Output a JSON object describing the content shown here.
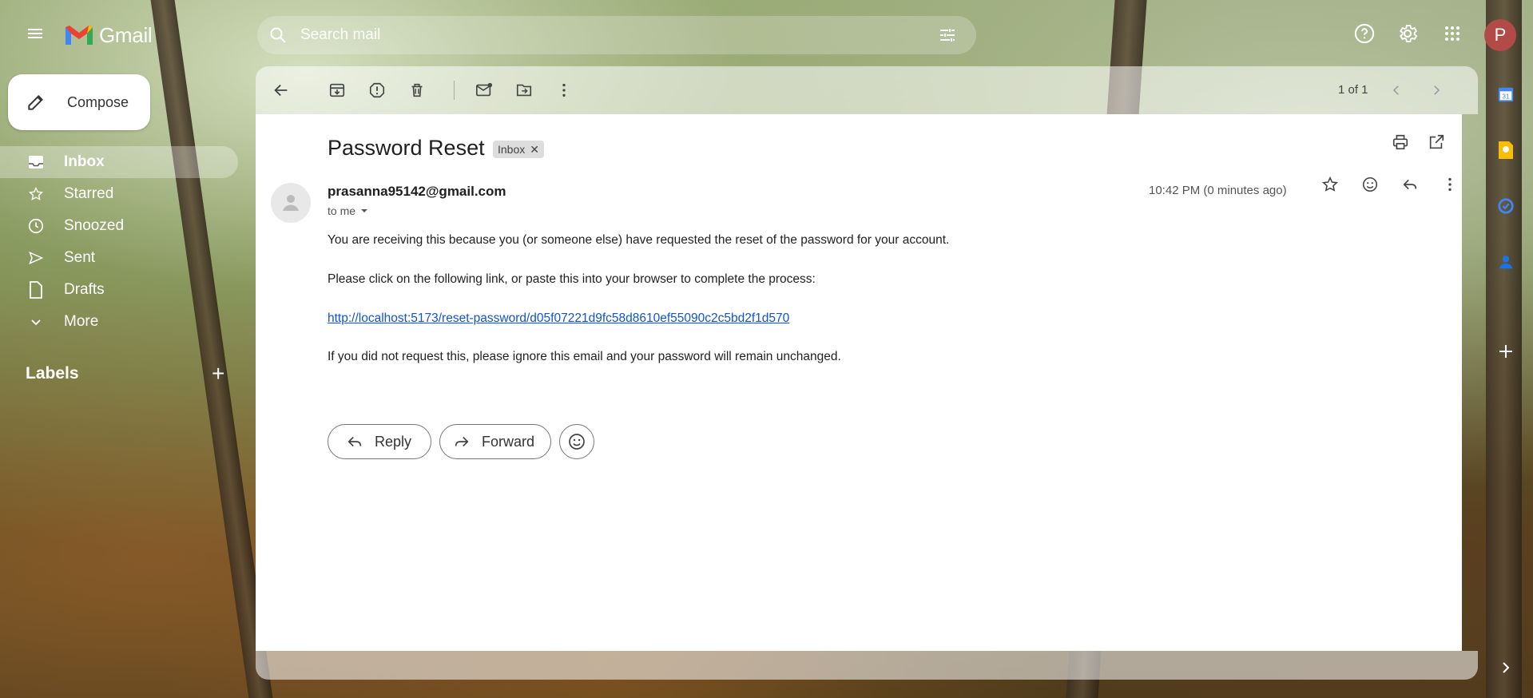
{
  "app": {
    "name": "Gmail"
  },
  "search": {
    "placeholder": "Search mail"
  },
  "account": {
    "initial": "P"
  },
  "compose": {
    "label": "Compose"
  },
  "nav": {
    "items": [
      {
        "label": "Inbox",
        "icon": "inbox-icon",
        "active": true
      },
      {
        "label": "Starred",
        "icon": "star-icon"
      },
      {
        "label": "Snoozed",
        "icon": "clock-icon"
      },
      {
        "label": "Sent",
        "icon": "send-icon"
      },
      {
        "label": "Drafts",
        "icon": "draft-icon"
      },
      {
        "label": "More",
        "icon": "chevron-down-icon"
      }
    ],
    "labels_heading": "Labels"
  },
  "toolbar": {
    "pager": "1 of 1"
  },
  "email": {
    "subject": "Password Reset",
    "chip": "Inbox",
    "sender": "prasanna95142@gmail.com",
    "to": "to me",
    "time": "10:42 PM (0 minutes ago)",
    "body": [
      "You are receiving this because you (or someone else) have requested the reset of the password for your account.",
      "Please click on the following link, or paste this into your browser to complete the process:",
      "http://localhost:5173/reset-password/d05f07221d9fc58d8610ef55090c2c5bd2f1d570",
      "If you did not request this, please ignore this email and your password will remain unchanged."
    ]
  },
  "actions": {
    "reply": "Reply",
    "forward": "Forward"
  },
  "colors": {
    "accent": "#b24a47",
    "link": "#1155cc"
  }
}
